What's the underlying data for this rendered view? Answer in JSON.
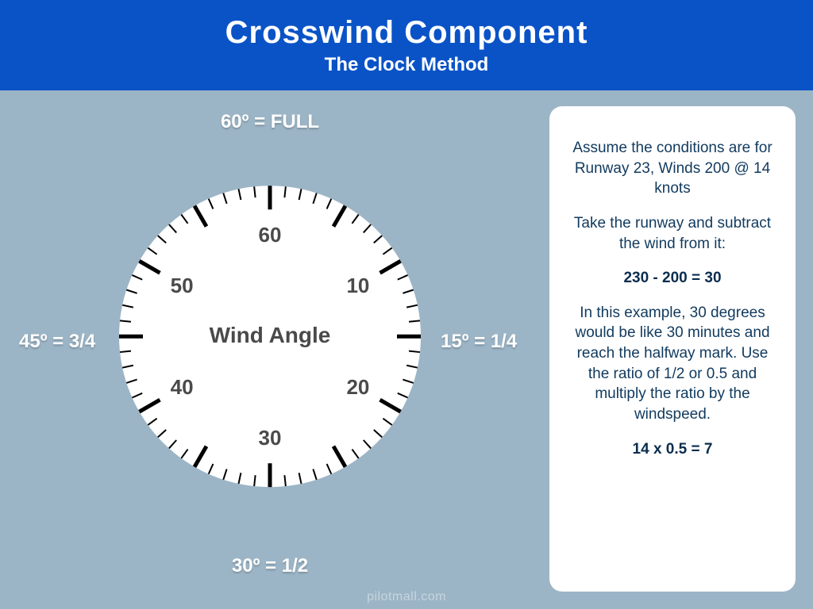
{
  "header": {
    "title": "Crosswind Component",
    "subtitle": "The Clock Method"
  },
  "dial": {
    "center_label": "Wind Angle",
    "hour_numbers": [
      "60",
      "10",
      "20",
      "30",
      "40",
      "50"
    ],
    "outer_labels": {
      "top": "60º = FULL",
      "right": "15º = 1/4",
      "bottom": "30º = 1/2",
      "left": "45º = 3/4"
    }
  },
  "card": {
    "p1": "Assume the conditions are for Runway 23, Winds 200 @ 14 knots",
    "p2": "Take the runway and subtract the wind from it:",
    "eq1": "230 - 200 = 30",
    "p3": "In this example, 30 degrees would be like 30 minutes and reach the halfway mark. Use the ratio of 1/2 or 0.5 and multiply the ratio by the windspeed.",
    "eq2": "14 x 0.5 = 7"
  },
  "footer": "pilotmall.com"
}
